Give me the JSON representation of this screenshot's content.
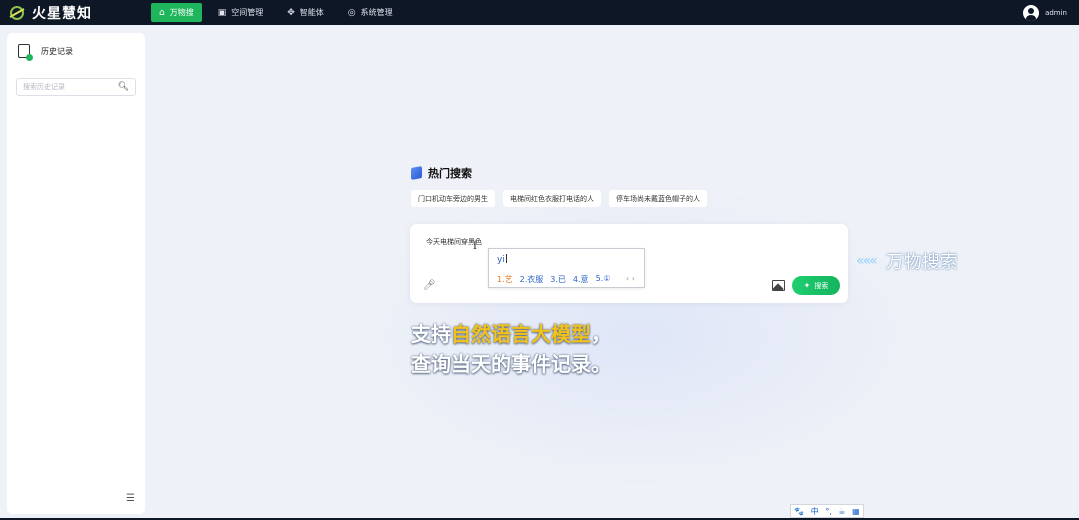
{
  "app": {
    "name": "火星慧知"
  },
  "nav": {
    "items": [
      {
        "label": "万物搜",
        "icon": "home-icon",
        "glyph": "⌂",
        "active": true
      },
      {
        "label": "空间管理",
        "icon": "space-icon",
        "glyph": "▣",
        "active": false
      },
      {
        "label": "智能体",
        "icon": "agent-icon",
        "glyph": "✥",
        "active": false
      },
      {
        "label": "系统管理",
        "icon": "system-settings-icon",
        "glyph": "◎",
        "active": false
      }
    ]
  },
  "user": {
    "name": "admin"
  },
  "sidebar": {
    "title": "历史记录",
    "search_placeholder": "搜索历史记录",
    "collapse_glyph": "☰"
  },
  "hot_search": {
    "title": "热门搜索",
    "chips": [
      "门口机动车旁边的男生",
      "电梯间红色衣服打电话的人",
      "停车场尚未戴蓝色帽子的人"
    ]
  },
  "search": {
    "query": "今天电梯间穿黑色",
    "button_label": "搜索",
    "cursor_glyph": "I"
  },
  "ime": {
    "pinyin": "yi",
    "candidates": [
      "1.艺",
      "2.衣服",
      "3.已",
      "4.意",
      "5.①"
    ],
    "arrows": "‹ ›"
  },
  "badge": {
    "chevrons": "«««",
    "label": "万物搜索"
  },
  "slogan": {
    "line1_prefix": "支持",
    "line1_highlight": "自然语言大模型",
    "line1_suffix": "，",
    "line2": "查询当天的事件记录。"
  },
  "ime_status": {
    "items": [
      "🐾",
      "中",
      "°,",
      "☕",
      "▦"
    ]
  },
  "colors": {
    "accent": "#1fb55c",
    "topbar": "#0e1726",
    "highlight": "#f2c21a"
  }
}
